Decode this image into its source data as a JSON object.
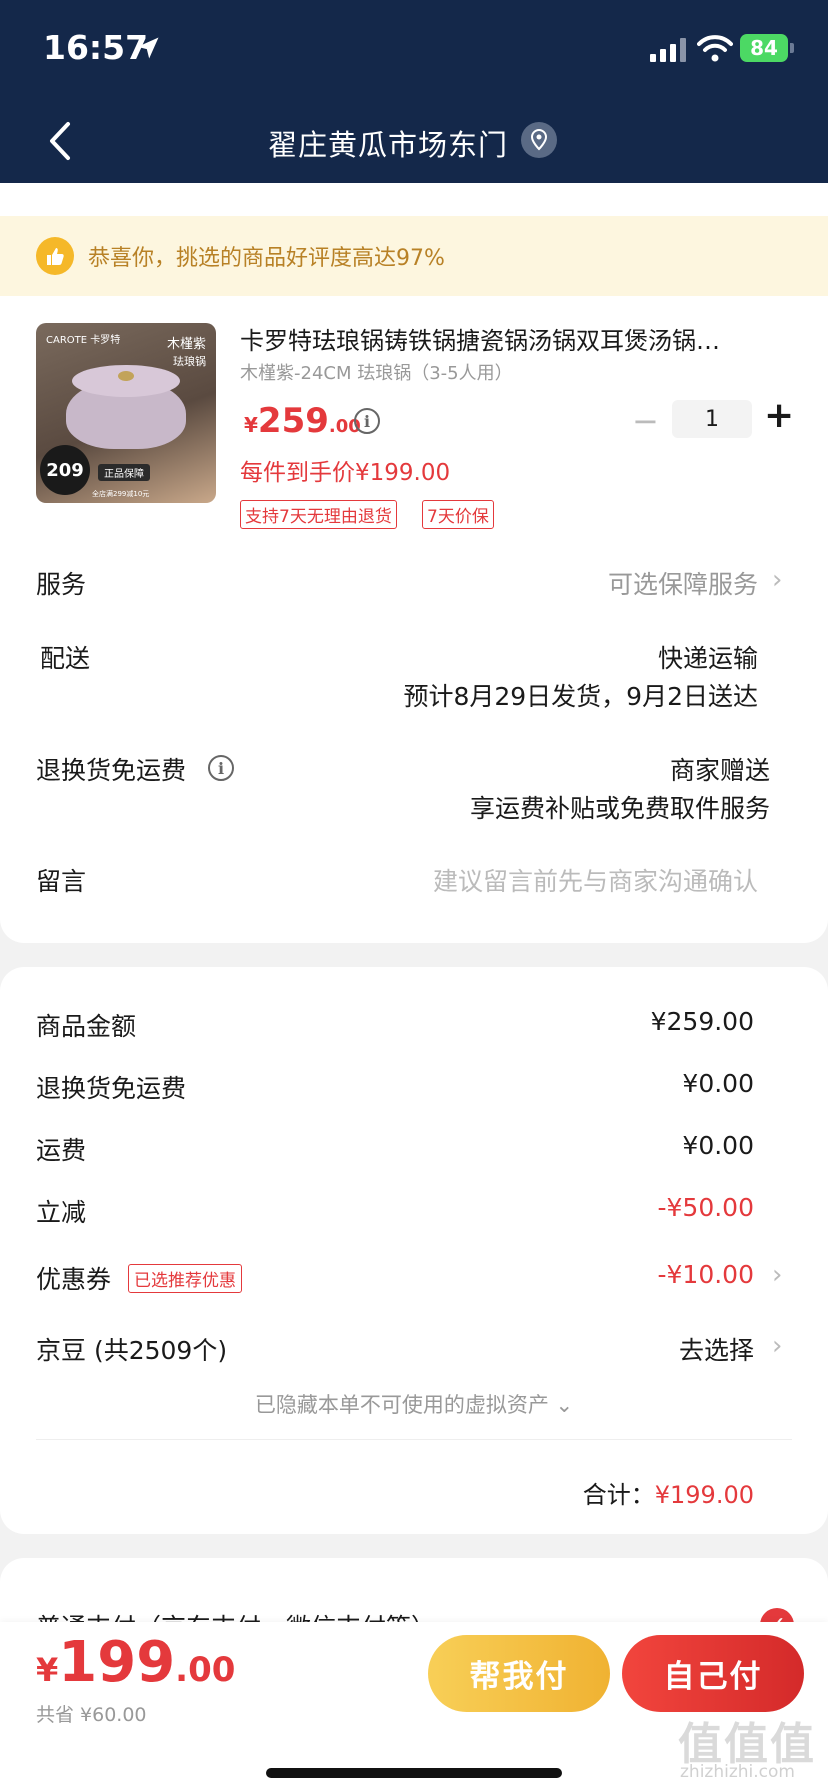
{
  "status_bar": {
    "time": "16:57",
    "battery": "84"
  },
  "header": {
    "title": "翟庄黄瓜市场东门"
  },
  "banner": {
    "text": "恭喜你，挑选的商品好评度高达97%"
  },
  "product": {
    "image_brand": "CAROTE 卡罗特",
    "image_name": "木槿紫",
    "image_sub": "珐琅锅",
    "image_price_badge": "209",
    "image_guarantee": "正品保障",
    "image_promo": "全店满299减10元",
    "title": "卡罗特珐琅锅铸铁锅搪瓷锅汤锅双耳煲汤锅…",
    "spec": "木槿紫-24CM 珐琅锅（3-5人用）",
    "price_yen": "¥",
    "price_int": "259",
    "price_dec": ".00",
    "quantity": "1",
    "net_price": "每件到手价¥199.00",
    "tags": [
      "支持7天无理由退货",
      "7天价保"
    ]
  },
  "service": {
    "label": "服务",
    "value": "可选保障服务"
  },
  "delivery": {
    "label": "配送",
    "method": "快递运输",
    "estimate": "预计8月29日发货，9月2日送达"
  },
  "return_shipping": {
    "label": "退换货免运费",
    "value1": "商家赠送",
    "value2": "享运费补贴或免费取件服务"
  },
  "message": {
    "label": "留言",
    "placeholder": "建议留言前先与商家沟通确认"
  },
  "summary": {
    "goods_label": "商品金额",
    "goods_value": "¥259.00",
    "return_label": "退换货免运费",
    "return_value": "¥0.00",
    "freight_label": "运费",
    "freight_value": "¥0.00",
    "discount_label": "立减",
    "discount_value": "-¥50.00",
    "coupon_label": "优惠券",
    "coupon_tag": "已选推荐优惠",
    "coupon_value": "-¥10.00",
    "jingdou_label": "京豆 (共2509个)",
    "jingdou_value": "去选择",
    "hidden_assets": "已隐藏本单不可使用的虚拟资产",
    "total_label": "合计：",
    "total_value": "¥199.00"
  },
  "payment": {
    "label": "普通支付（京东支付、微信支付等）"
  },
  "bottom": {
    "yen": "¥",
    "int": "199",
    "dec": ".00",
    "saved": "共省 ¥60.00",
    "help_button": "帮我付",
    "self_button": "自己付"
  },
  "watermark": {
    "main": "值值值",
    "sub": "zhizhizhi.com"
  },
  "colors": {
    "accent_red": "#e4393c",
    "header_navy": "#14284a",
    "banner_gold": "#b88126"
  }
}
